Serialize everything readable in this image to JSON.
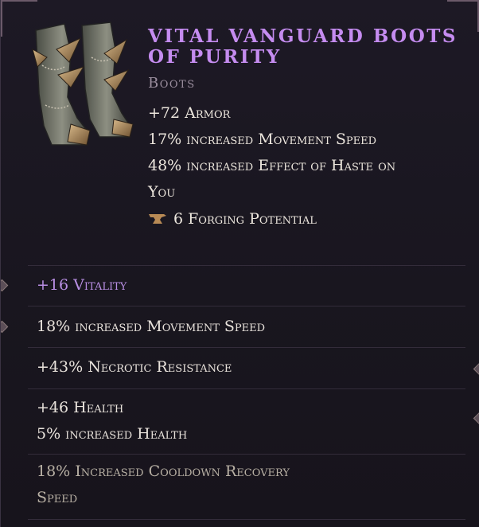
{
  "item": {
    "name": "Vital Vanguard Boots of Purity",
    "type": "Boots"
  },
  "implicits": [
    "+72 Armor",
    "17% increased Movement Speed",
    "48% increased Effect of Haste on",
    "You"
  ],
  "forging": {
    "icon": "anvil-icon",
    "text": "6 Forging Potential"
  },
  "affixes": [
    {
      "lines": [
        "+16 Vitality"
      ]
    },
    {
      "lines": [
        "18% increased Movement Speed"
      ]
    },
    {
      "lines": [
        "+43% Necrotic Resistance"
      ]
    },
    {
      "lines": [
        "+46 Health",
        "5% increased Health"
      ]
    },
    {
      "lines": [
        "18% Increased Cooldown Recovery",
        "Speed"
      ]
    }
  ],
  "colors": {
    "item_name": "#c58cf0",
    "prefix_affix": "#b98fe4",
    "normal_text": "#e9e3dc",
    "background": "#1a1520"
  }
}
